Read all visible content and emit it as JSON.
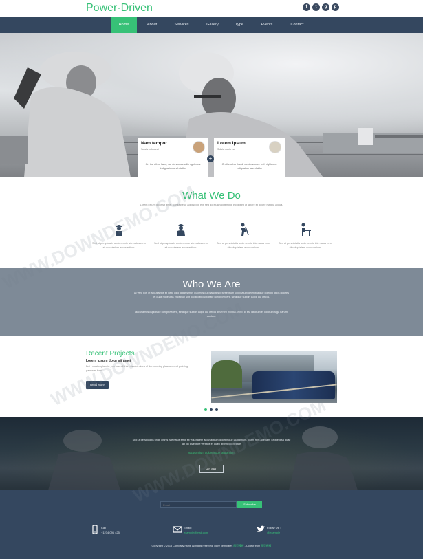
{
  "header": {
    "brand": "Power-Driven",
    "social_icons": [
      "facebook-icon",
      "twitter-icon",
      "google-plus-icon",
      "pinterest-icon"
    ],
    "social_glyphs": [
      "f",
      "t",
      "g",
      "p"
    ]
  },
  "nav": {
    "items": [
      "Home",
      "About",
      "Services",
      "Gallery",
      "Type",
      "Events",
      "Contact"
    ],
    "active": "Home"
  },
  "hero": {
    "cards": [
      {
        "title": "Nam tempor",
        "subtitle": "Soluta nobis est",
        "body": "On the other hand, we denounce with righteous indignation and dislike"
      },
      {
        "title": "Lorem Ipsum",
        "subtitle": "Soluta nobis est",
        "body": "On the other hand, we denounce with righteous indignation and dislike"
      }
    ]
  },
  "what_we_do": {
    "title": "What We Do",
    "subtitle": "Lorem ipsum dolor sit amet, consectetur adipisicing elit, sed do eiusmod tempor incididunt ut labore et dolore magna aliqua.",
    "services": [
      {
        "text": "Sed ut perspiciatis unde omnis iste natus error sit voluptatem accusantium."
      },
      {
        "text": "Sed ut perspiciatis unde omnis iste natus error sit voluptatem accusantium."
      },
      {
        "text": "Sed ut perspiciatis unde omnis iste natus error sit voluptatem accusantium."
      },
      {
        "text": "Sed ut perspiciatis unde omnis iste natus error sit voluptatem accusantium."
      }
    ]
  },
  "who_we_are": {
    "title": "Who We Are",
    "paragraph1": "At vero eos et accusamus et iusto odio dignissimos ducimus qui blanditiis praesentium voluptatum deleniti atque corrupti quos dolores et quas molestias excepturi sint occaecati cupiditate non provident, similique sunt in culpa qui officia.",
    "paragraph2": "accusamus cupiditate non provident, similique sunt in culpa qui officia deserunt mollitia animi, id est laborum et dolorum fuga harum quidem."
  },
  "recent_projects": {
    "title": "Recent Projects",
    "subtitle": "Lorem ipsum dolor sit amet",
    "text": "But I must explain to you how all this mistaken idea of denouncing pleasure and praising pain was born.",
    "button": "Read More"
  },
  "cta": {
    "text": "Sed ut perspiciatis unde omnis iste natus error sit voluptatem accusantium doloremque laudantium, totam rem aperiam, eaque ipsa quae ab illo inventore veritatis et quasi architecto beatae",
    "highlight": "accusantium doloremque laudantium",
    "button": "Get Start"
  },
  "footer": {
    "email_placeholder": "Email",
    "subscribe": "Subscribe",
    "call": {
      "label": "Call :",
      "value": "+1234 096 425"
    },
    "email": {
      "label": "Email :",
      "value": "example@mail.com"
    },
    "follow": {
      "label": "Follow Us :",
      "value": "@example"
    },
    "copyright": "Copyright © 2015 Company name All rights reserved.",
    "copyright_tail": "More Templates",
    "copyright_collect": "- Collect from",
    "copyright_green1": "网页模板",
    "copyright_green2": "网页模板"
  },
  "watermark": "WWW.DOWNDEMO.COM",
  "colors": {
    "accent": "#37c177",
    "navy": "#34475f",
    "slate": "#7e8a97"
  }
}
